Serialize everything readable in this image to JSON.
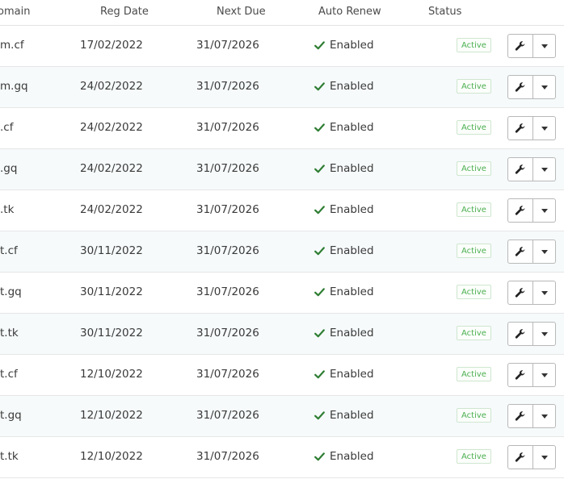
{
  "table": {
    "headers": {
      "domain": "omain",
      "reg_date": "Reg Date",
      "next_due": "Next Due",
      "auto_renew": "Auto Renew",
      "status": "Status"
    },
    "rows": [
      {
        "domain": "m.cf",
        "reg_date": "17/02/2022",
        "next_due": "31/07/2026",
        "auto_renew": "Enabled",
        "status": "Active"
      },
      {
        "domain": "m.gq",
        "reg_date": "24/02/2022",
        "next_due": "31/07/2026",
        "auto_renew": "Enabled",
        "status": "Active"
      },
      {
        "domain": ".cf",
        "reg_date": "24/02/2022",
        "next_due": "31/07/2026",
        "auto_renew": "Enabled",
        "status": "Active"
      },
      {
        "domain": ".gq",
        "reg_date": "24/02/2022",
        "next_due": "31/07/2026",
        "auto_renew": "Enabled",
        "status": "Active"
      },
      {
        "domain": ".tk",
        "reg_date": "24/02/2022",
        "next_due": "31/07/2026",
        "auto_renew": "Enabled",
        "status": "Active"
      },
      {
        "domain": "t.cf",
        "reg_date": "30/11/2022",
        "next_due": "31/07/2026",
        "auto_renew": "Enabled",
        "status": "Active"
      },
      {
        "domain": "t.gq",
        "reg_date": "30/11/2022",
        "next_due": "31/07/2026",
        "auto_renew": "Enabled",
        "status": "Active"
      },
      {
        "domain": "t.tk",
        "reg_date": "30/11/2022",
        "next_due": "31/07/2026",
        "auto_renew": "Enabled",
        "status": "Active"
      },
      {
        "domain": "t.cf",
        "reg_date": "12/10/2022",
        "next_due": "31/07/2026",
        "auto_renew": "Enabled",
        "status": "Active"
      },
      {
        "domain": "t.gq",
        "reg_date": "12/10/2022",
        "next_due": "31/07/2026",
        "auto_renew": "Enabled",
        "status": "Active"
      },
      {
        "domain": "t.tk",
        "reg_date": "12/10/2022",
        "next_due": "31/07/2026",
        "auto_renew": "Enabled",
        "status": "Active"
      }
    ]
  },
  "icons": {
    "renew": "check-icon",
    "manage": "wrench-icon",
    "menu": "caret-down-icon"
  },
  "colors": {
    "check": "#2e7d32",
    "status_active": "#4caf50",
    "row_alt_bg": "#f6fafb"
  }
}
